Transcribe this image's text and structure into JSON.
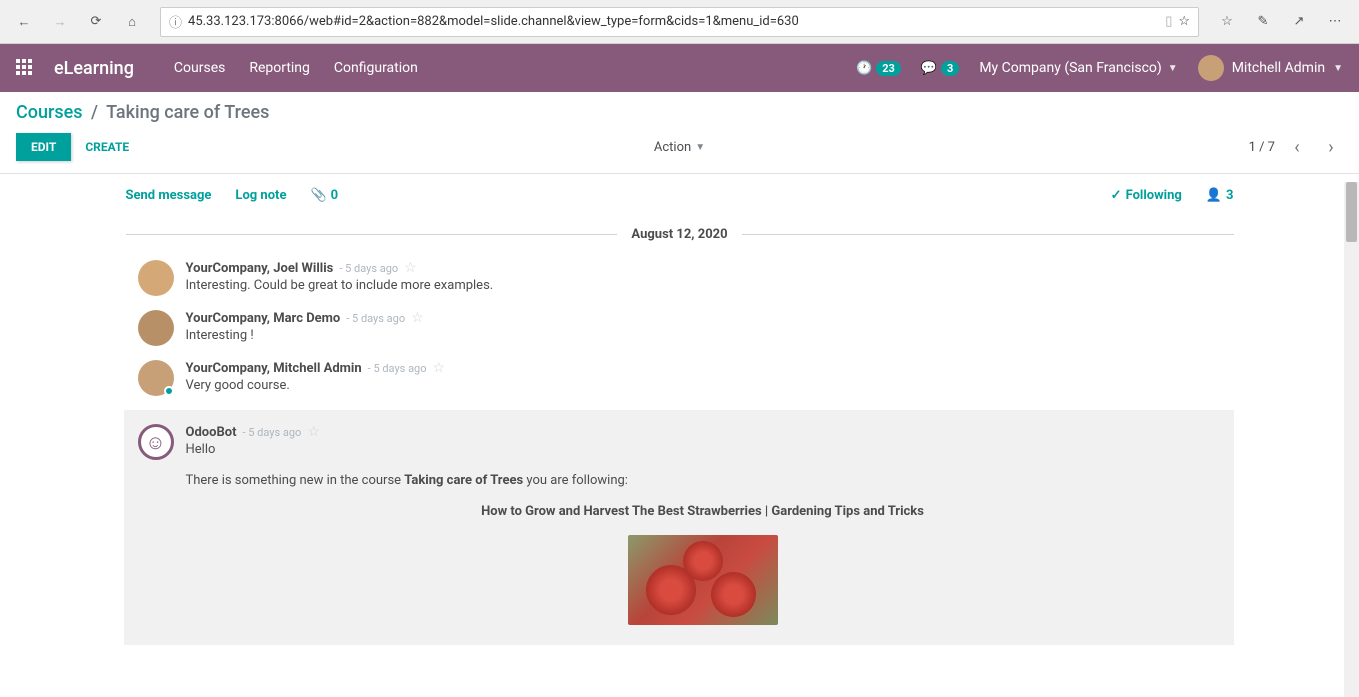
{
  "browser": {
    "url": "45.33.123.173:8066/web#id=2&action=882&model=slide.channel&view_type=form&cids=1&menu_id=630"
  },
  "nav": {
    "brand": "eLearning",
    "links": [
      "Courses",
      "Reporting",
      "Configuration"
    ],
    "activity_count": "23",
    "discuss_count": "3",
    "company": "My Company (San Francisco)",
    "user": "Mitchell Admin"
  },
  "breadcrumb": {
    "root": "Courses",
    "current": "Taking care of Trees"
  },
  "actions": {
    "edit": "Edit",
    "create": "Create",
    "action": "Action",
    "pager": "1 / 7"
  },
  "chatter": {
    "send_message": "Send message",
    "log_note": "Log note",
    "attachments": "0",
    "following": "Following",
    "followers": "3",
    "date": "August 12, 2020"
  },
  "messages": [
    {
      "author": "YourCompany, Joel Willis",
      "time": "- 5 days ago",
      "text": "Interesting. Could be great to include more examples."
    },
    {
      "author": "YourCompany, Marc Demo",
      "time": "- 5 days ago",
      "text": "Interesting !"
    },
    {
      "author": "YourCompany, Mitchell Admin",
      "time": "- 5 days ago",
      "text": "Very good course."
    }
  ],
  "odoobot": {
    "author": "OdooBot",
    "time": "- 5 days ago",
    "hello": "Hello",
    "line_prefix": "There is something new in the course ",
    "course": "Taking care of Trees",
    "line_suffix": " you are following:",
    "content_title": "How to Grow and Harvest The Best Strawberries | Gardening Tips and Tricks"
  }
}
